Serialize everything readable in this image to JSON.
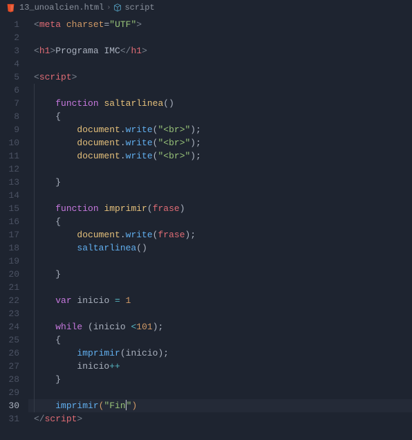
{
  "breadcrumb": {
    "file": "13_unoalcien.html",
    "symbol": "script",
    "html5_icon": "html5-icon",
    "cube_icon": "cube-icon"
  },
  "lines": {
    "n1": 1,
    "n2": 2,
    "n3": 3,
    "n4": 4,
    "n5": 5,
    "n6": 6,
    "n7": 7,
    "n8": 8,
    "n9": 9,
    "n10": 10,
    "n11": 11,
    "n12": 12,
    "n13": 13,
    "n14": 14,
    "n15": 15,
    "n16": 16,
    "n17": 17,
    "n18": 18,
    "n19": 19,
    "n20": 20,
    "n21": 21,
    "n22": 22,
    "n23": 23,
    "n24": 24,
    "n25": 25,
    "n26": 26,
    "n27": 27,
    "n28": 28,
    "n29": 29,
    "n30": 30,
    "n31": 31
  },
  "tok": {
    "lt": "<",
    "gt": ">",
    "ltsl": "</",
    "sgt": ">",
    "meta": "meta",
    "charset": "charset",
    "eq": "=",
    "utf": "\"UTF\"",
    "h1": "h1",
    "programa": "Programa IMC",
    "script": "script",
    "function": "function",
    "saltarlinea": "saltarlinea",
    "lpar": "(",
    "rpar": ")",
    "lbrace": "{",
    "rbrace": "}",
    "document": "document",
    "dot": ".",
    "write": "write",
    "brstr": "\"<br>\"",
    "semi": ";",
    "imprimir": "imprimir",
    "frase": "frase",
    "var": "var",
    "inicio": "inicio",
    "assign": " = ",
    "one": "1",
    "while": "while",
    "lt_op": " <",
    "n101": "101",
    "plusplus": "++",
    "finstr": "\"Fin\"",
    "fin_q1": "\"Fin",
    "fin_q2": "\""
  },
  "colors": {
    "background": "#1e2430",
    "gutter": "#4b5263",
    "string": "#98c379",
    "keyword": "#c678dd",
    "function": "#61afef",
    "tag": "#e06c75",
    "attr": "#d19a66",
    "number": "#d19a66",
    "object": "#e5c07b"
  }
}
